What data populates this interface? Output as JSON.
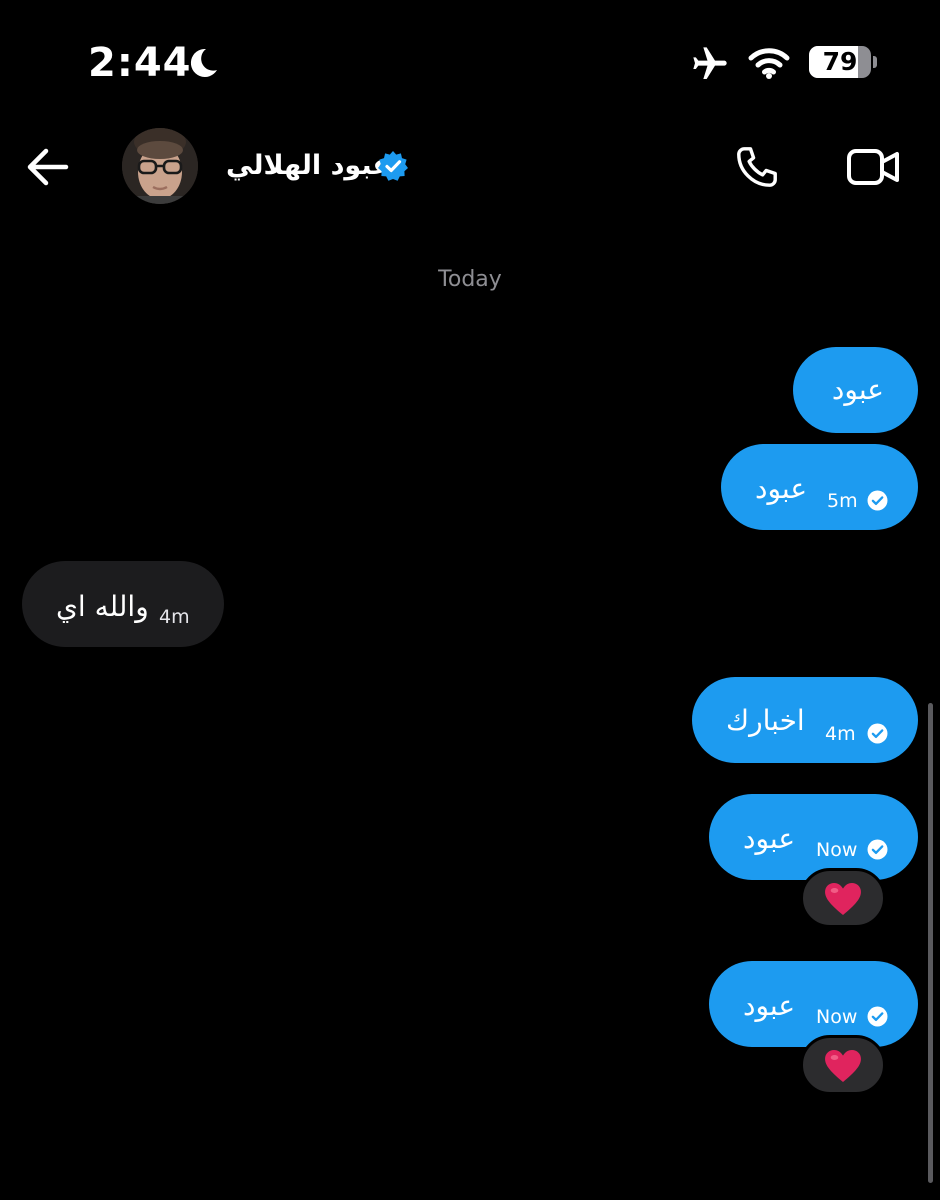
{
  "status_bar": {
    "time": "2:44",
    "battery_percent": "79",
    "battery_level": 0.79,
    "icons": [
      "moon-icon",
      "airplane-icon",
      "wifi-icon",
      "battery-icon"
    ]
  },
  "header": {
    "contact_name": "عبود الهلالي",
    "verified": true,
    "icons": [
      "back-arrow-icon",
      "avatar",
      "verified-badge-icon",
      "phone-call-icon",
      "video-call-icon"
    ]
  },
  "conversation": {
    "day_divider": "Today",
    "messages": [
      {
        "direction": "outgoing",
        "text": "عبود",
        "time": "",
        "seen": false,
        "reaction": ""
      },
      {
        "direction": "outgoing",
        "text": "عبود",
        "time": "5m",
        "seen": true,
        "reaction": ""
      },
      {
        "direction": "incoming",
        "text": "والله اي",
        "time": "4m",
        "seen": false,
        "reaction": ""
      },
      {
        "direction": "outgoing",
        "text": "اخبارك",
        "time": "4m",
        "seen": true,
        "reaction": ""
      },
      {
        "direction": "outgoing",
        "text": "عبود",
        "time": "Now",
        "seen": true,
        "reaction": "heart"
      },
      {
        "direction": "outgoing",
        "text": "عبود",
        "time": "Now",
        "seen": true,
        "reaction": "heart"
      }
    ]
  },
  "colors": {
    "background": "#000000",
    "outgoing_bubble": "#1d9bf0",
    "incoming_bubble": "#1c1c1e",
    "secondary_text": "#8e8e93",
    "verified_badge": "#1d9bf0",
    "reaction_heart": "#e0245e"
  }
}
